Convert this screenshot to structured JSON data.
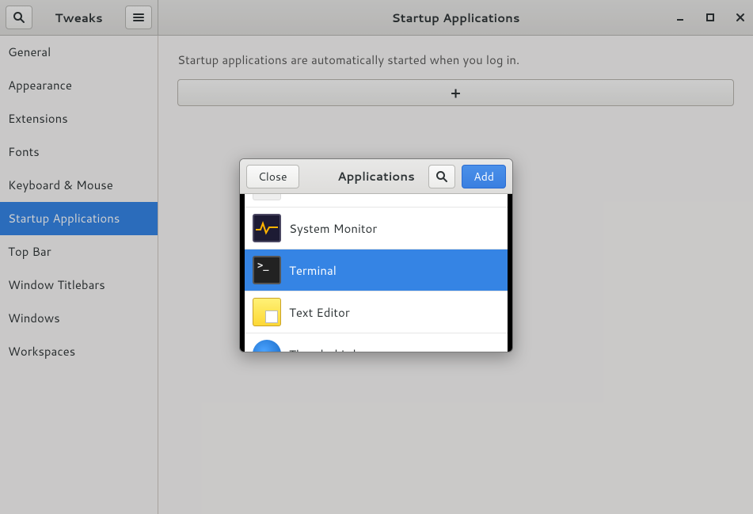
{
  "header": {
    "app_title": "Tweaks",
    "page_title": "Startup Applications"
  },
  "sidebar": {
    "items": [
      {
        "label": "General"
      },
      {
        "label": "Appearance"
      },
      {
        "label": "Extensions"
      },
      {
        "label": "Fonts"
      },
      {
        "label": "Keyboard & Mouse"
      },
      {
        "label": "Startup Applications"
      },
      {
        "label": "Top Bar"
      },
      {
        "label": "Window Titlebars"
      },
      {
        "label": "Windows"
      },
      {
        "label": "Workspaces"
      }
    ],
    "selected_index": 5
  },
  "main": {
    "description": "Startup applications are automatically started when you log in.",
    "add_symbol": "+"
  },
  "dialog": {
    "title": "Applications",
    "close_label": "Close",
    "add_label": "Add",
    "apps": [
      {
        "name": "",
        "icon": "blank"
      },
      {
        "name": "System Monitor",
        "icon": "sysmon"
      },
      {
        "name": "Terminal",
        "icon": "term"
      },
      {
        "name": "Text Editor",
        "icon": "text"
      },
      {
        "name": "Thunderbird",
        "icon": "tbird"
      }
    ],
    "selected_index": 2
  }
}
